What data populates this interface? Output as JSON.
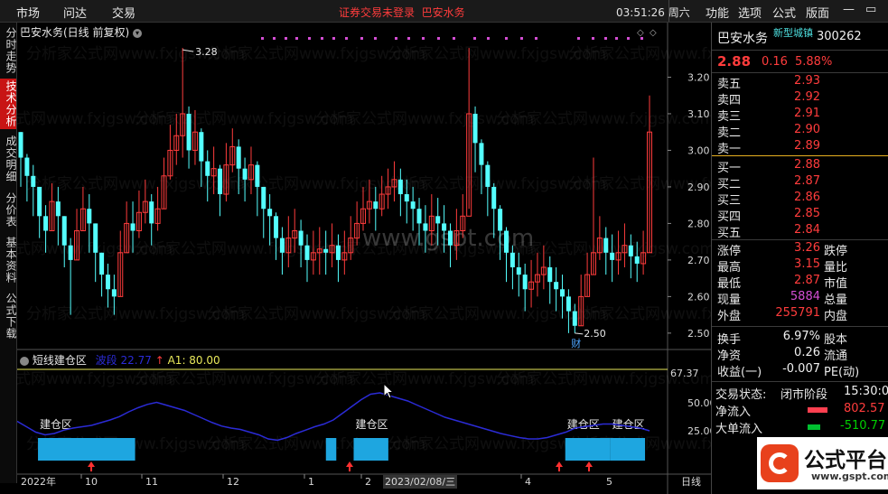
{
  "topbar": {
    "menu": [
      "市场",
      "问达",
      "交易"
    ],
    "notice": "证券交易未登录",
    "stock_name": "巴安水务",
    "clock": "03:51:26 周六",
    "right_menu": [
      "功能",
      "选项",
      "公式",
      "版面"
    ],
    "win_minimize": "—",
    "win_restore": "▭",
    "win_close": "✕",
    "left_arrow": "◀"
  },
  "left_tabs": [
    "分时走势",
    "技术分析",
    "成交明细",
    "分价表",
    "基本资料",
    "公式下载"
  ],
  "main_chart": {
    "title": "巴安水务(日线 前复权)",
    "high_label": "3.28",
    "low_label": "2.50",
    "low_marker": "财",
    "watermark": "www.gspt.com",
    "watermark_bg": "分析家公式网www.fxjgsw.com"
  },
  "chart_data": [
    {
      "type": "candlestick",
      "title": "巴安水务(日线 前复权)",
      "y_ticks": [
        "3.20",
        "3.10",
        "3.00",
        "2.90",
        "2.80",
        "2.70",
        "2.60",
        "2.50"
      ],
      "ylim": [
        2.47,
        3.3
      ],
      "annotations": {
        "high": 3.28,
        "low": 2.5
      },
      "closes": [
        2.98,
        2.93,
        2.9,
        2.82,
        2.78,
        2.86,
        2.82,
        2.74,
        2.7,
        2.78,
        2.84,
        2.8,
        2.72,
        2.66,
        2.62,
        2.6,
        2.72,
        2.8,
        2.78,
        2.83,
        2.86,
        2.8,
        2.84,
        2.93,
        3.0,
        3.04,
        3.1,
        3.0,
        3.05,
        2.97,
        2.93,
        2.95,
        2.88,
        2.96,
        3.01,
        2.95,
        2.92,
        2.96,
        2.9,
        2.84,
        2.82,
        2.76,
        2.72,
        2.76,
        2.78,
        2.74,
        2.7,
        2.72,
        2.73,
        2.72,
        2.74,
        2.7,
        2.72,
        2.76,
        2.8,
        2.84,
        2.86,
        2.84,
        2.88,
        2.9,
        2.92,
        2.88,
        2.86,
        2.84,
        2.8,
        2.78,
        2.82,
        2.8,
        2.78,
        2.74,
        2.78,
        2.82,
        3.1,
        3.02,
        2.96,
        2.9,
        2.84,
        2.78,
        2.72,
        2.68,
        2.66,
        2.62,
        2.64,
        2.66,
        2.68,
        2.64,
        2.62,
        2.6,
        2.56,
        2.52,
        2.6,
        2.66,
        2.72,
        2.76,
        2.72,
        2.7,
        2.72,
        2.74,
        2.71,
        2.69,
        2.72,
        3.05
      ],
      "highs": [
        3.05,
        2.99,
        2.96,
        2.9,
        2.85,
        2.91,
        2.9,
        2.82,
        2.76,
        2.84,
        2.9,
        2.88,
        2.8,
        2.72,
        2.69,
        2.66,
        2.78,
        2.86,
        2.86,
        2.89,
        2.92,
        2.88,
        2.9,
        2.98,
        3.07,
        3.1,
        3.28,
        3.12,
        3.11,
        3.06,
        3.0,
        3.01,
        2.96,
        3.02,
        3.06,
        3.03,
        2.98,
        3.01,
        2.97,
        2.9,
        2.88,
        2.83,
        2.79,
        2.82,
        2.84,
        2.81,
        2.77,
        2.78,
        2.79,
        2.78,
        2.8,
        2.77,
        2.78,
        2.82,
        2.86,
        2.9,
        2.92,
        2.9,
        2.93,
        2.95,
        2.97,
        2.95,
        2.92,
        2.9,
        2.87,
        2.85,
        2.88,
        2.87,
        2.85,
        2.8,
        2.84,
        2.88,
        3.28,
        3.12,
        3.03,
        2.97,
        2.91,
        2.85,
        2.79,
        2.74,
        2.72,
        2.69,
        2.7,
        2.72,
        2.74,
        2.71,
        2.68,
        2.66,
        2.62,
        2.58,
        2.66,
        2.72,
        2.98,
        2.82,
        2.79,
        2.77,
        2.78,
        2.8,
        2.77,
        2.75,
        2.78,
        3.15
      ],
      "lows": [
        2.9,
        2.86,
        2.82,
        2.76,
        2.72,
        2.78,
        2.74,
        2.68,
        2.55,
        2.7,
        2.78,
        2.72,
        2.64,
        2.6,
        2.57,
        2.55,
        2.6,
        2.72,
        2.72,
        2.76,
        2.8,
        2.74,
        2.78,
        2.84,
        2.92,
        2.96,
        2.98,
        2.95,
        2.96,
        2.9,
        2.86,
        2.88,
        2.82,
        2.86,
        2.94,
        2.88,
        2.86,
        2.88,
        2.82,
        2.76,
        2.74,
        2.7,
        2.66,
        2.68,
        2.72,
        2.68,
        2.64,
        2.66,
        2.66,
        2.66,
        2.68,
        2.64,
        2.66,
        2.7,
        2.74,
        2.78,
        2.8,
        2.78,
        2.82,
        2.84,
        2.86,
        2.82,
        2.8,
        2.78,
        2.74,
        2.72,
        2.74,
        2.74,
        2.72,
        2.68,
        2.7,
        2.76,
        2.84,
        2.94,
        2.88,
        2.82,
        2.76,
        2.7,
        2.64,
        2.62,
        2.6,
        2.56,
        2.57,
        2.6,
        2.62,
        2.58,
        2.56,
        2.54,
        2.5,
        2.5,
        2.52,
        2.6,
        2.66,
        2.7,
        2.66,
        2.64,
        2.66,
        2.68,
        2.65,
        2.64,
        2.66,
        2.72
      ]
    },
    {
      "type": "line",
      "title": "短线建仓区",
      "series_label": "波段",
      "series_value": "22.77",
      "a1_label": "A1: 80.00",
      "y_ticks": [
        "67.37",
        "50.00",
        "25.00"
      ],
      "ylim": [
        0,
        100
      ],
      "line_values": [
        38,
        30,
        22,
        18,
        20,
        25,
        28,
        30,
        32,
        36,
        40,
        45,
        52,
        58,
        63,
        66,
        62,
        58,
        54,
        48,
        42,
        36,
        31,
        28,
        26,
        22,
        18,
        12,
        10,
        14,
        20,
        25,
        30,
        34,
        40,
        50,
        60,
        70,
        78,
        80,
        76,
        72,
        68,
        62,
        56,
        50,
        44,
        40,
        36,
        32,
        28,
        24,
        20,
        17,
        14,
        12,
        12,
        14,
        18,
        22,
        28,
        30,
        32,
        34,
        34,
        32,
        30,
        28,
        24
      ],
      "zones": [
        {
          "label": "建仓区",
          "start": 0.03,
          "end": 0.17
        },
        {
          "label": "",
          "start": 0.445,
          "end": 0.46
        },
        {
          "label": "建仓区",
          "start": 0.485,
          "end": 0.535
        },
        {
          "label": "建仓区",
          "start": 0.79,
          "end": 0.855
        },
        {
          "label": "建仓区",
          "start": 0.855,
          "end": 0.905
        }
      ],
      "x_ticks": [
        "2022年",
        "10",
        "11",
        "12",
        "1",
        "2",
        "2023/02/08/三",
        "4",
        "5",
        "日线"
      ]
    }
  ],
  "subchart": {
    "title": "短线建仓区",
    "series_label": "波段",
    "series_value": "22.77",
    "a1": "A1: 80.00",
    "zone_label": "建仓区",
    "cursor": "pointer"
  },
  "quote": {
    "name": "巴安水务",
    "sector": "新型城镇",
    "code": "300262",
    "price": "2.88",
    "change": "0.16",
    "change_pct": "5.88%",
    "asks": [
      {
        "label": "卖五",
        "price": "2.93"
      },
      {
        "label": "卖四",
        "price": "2.92"
      },
      {
        "label": "卖三",
        "price": "2.91"
      },
      {
        "label": "卖二",
        "price": "2.90"
      },
      {
        "label": "卖一",
        "price": "2.89"
      }
    ],
    "bids": [
      {
        "label": "买一",
        "price": "2.88"
      },
      {
        "label": "买二",
        "price": "2.87"
      },
      {
        "label": "买三",
        "price": "2.86"
      },
      {
        "label": "买四",
        "price": "2.85"
      },
      {
        "label": "买五",
        "price": "2.84"
      }
    ],
    "stats": [
      {
        "label": "涨停",
        "value": "3.26",
        "label2": "跌停"
      },
      {
        "label": "最高",
        "value": "3.15",
        "label2": "量比"
      },
      {
        "label": "最低",
        "value": "2.87",
        "label2": "市值"
      },
      {
        "label": "现量",
        "value": "5884",
        "label2": "总量"
      },
      {
        "label": "外盘",
        "value": "255791",
        "label2": "内盘"
      }
    ],
    "stats2": [
      {
        "label": "换手",
        "value": "6.97%",
        "label2": "股本"
      },
      {
        "label": "净资",
        "value": "0.26",
        "label2": "流通"
      },
      {
        "label": "收益(一)",
        "value": "-0.007",
        "label2": "PE(动)"
      }
    ],
    "trade_status_label": "交易状态:",
    "trade_status": "闭市阶段",
    "trade_time": "15:30:0",
    "net_in_label": "净流入",
    "net_in": "802.57",
    "big_in_label": "大单流入",
    "big_in": "-510.77"
  },
  "logo": {
    "text": "公式平台",
    "url": "www.gspt.com"
  },
  "colors": {
    "up": "#ff3c3c",
    "down": "#54ffff",
    "zone": "#1ea6e0",
    "line": "#2b2bd6",
    "yellow_line": "#e8e85a"
  }
}
